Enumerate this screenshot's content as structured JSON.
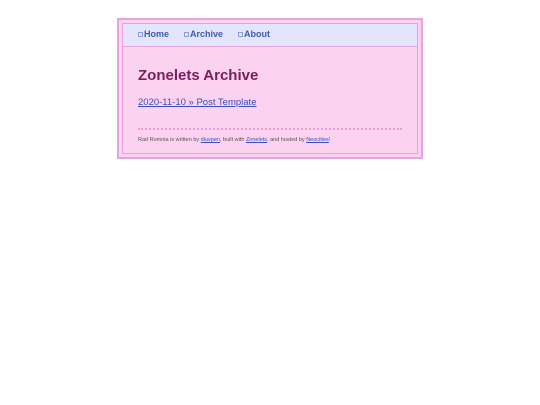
{
  "nav": {
    "items": [
      {
        "label": "Home"
      },
      {
        "label": "Archive"
      },
      {
        "label": "About"
      }
    ]
  },
  "main": {
    "title": "Zonelets Archive",
    "posts": [
      {
        "label": "2020-11-10 » Post Template"
      }
    ]
  },
  "footer": {
    "text_1": "Rad Romnia is written by ",
    "author_link": "diuvpen",
    "text_2": ", built with ",
    "zonelets_link": "Zonelets",
    "text_3": ", and hosted by ",
    "neocities_link": "Neocities",
    "text_4": "!"
  },
  "colors": {
    "background": "#fcd2f1",
    "nav_background": "#e3e5fb",
    "title": "#7a1f5a",
    "link": "#3a4fc0",
    "border": "#e7a3dd"
  }
}
